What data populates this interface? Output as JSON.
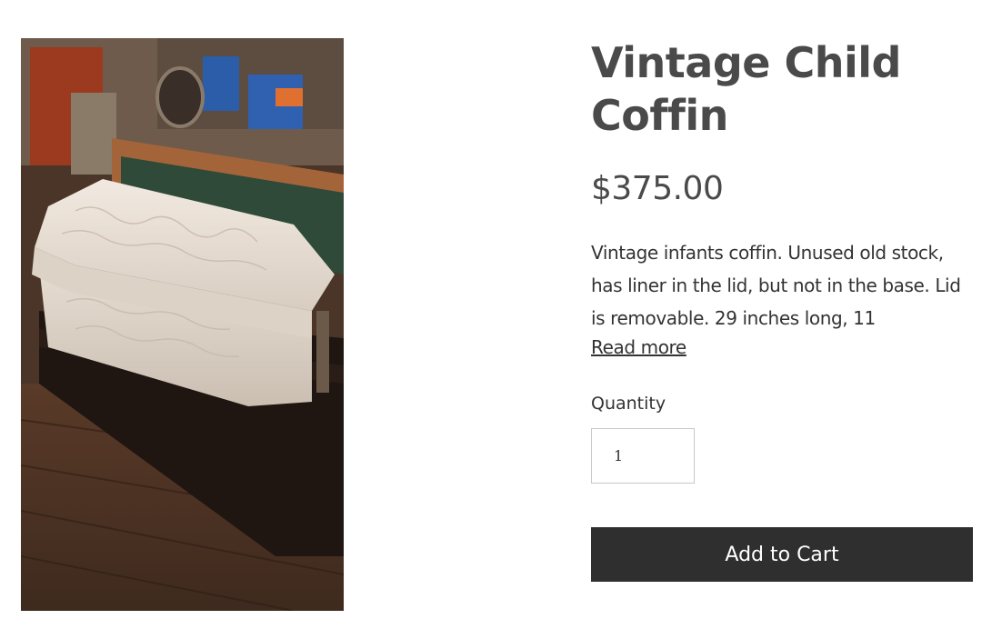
{
  "product": {
    "title": "Vintage Child Coffin",
    "price": "$375.00",
    "description": "Vintage infants coffin. Unused old stock, has liner in the lid, but not in the base. Lid is removable. 29 inches long, 11",
    "read_more_label": "Read more",
    "quantity_label": "Quantity",
    "quantity_value": "1",
    "add_to_cart_label": "Add to Cart",
    "image_alt": "white vintage child coffin on wooden floor"
  },
  "colors": {
    "title": "#4a4a4a",
    "button_bg": "#2f2f30",
    "button_text": "#ffffff"
  }
}
